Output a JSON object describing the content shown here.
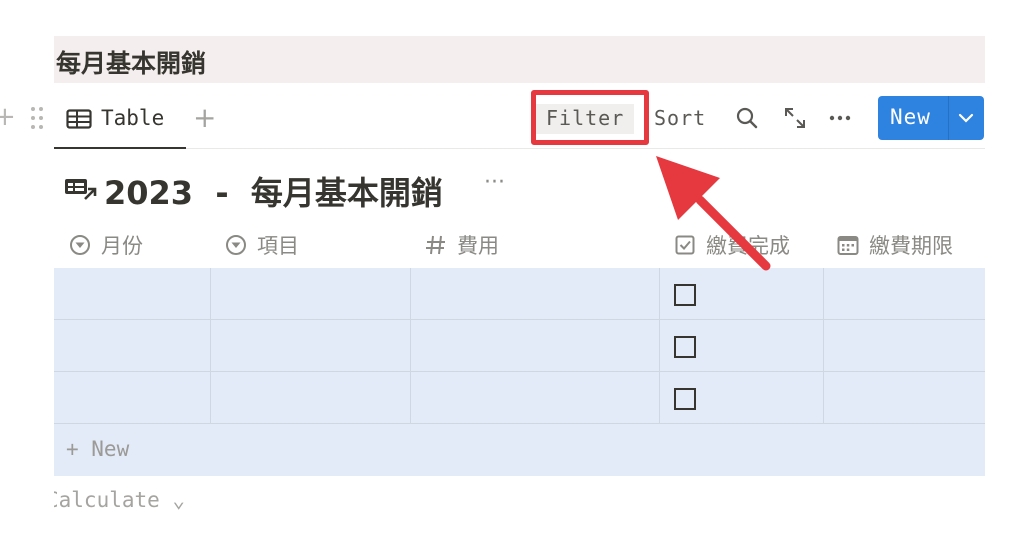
{
  "page": {
    "heading": "每月基本開銷"
  },
  "view_tabs": {
    "active_tab_label": "Table",
    "add_view_glyph": "+"
  },
  "toolbar": {
    "filter_label": "Filter",
    "sort_label": "Sort",
    "search_icon": "search-icon",
    "expand_icon": "expand-icon",
    "more_icon": "more-icon",
    "new_label": "New",
    "new_caret_icon": "chevron-down-icon"
  },
  "database": {
    "title": "2023  -  每月基本開銷",
    "more_glyph": "···",
    "columns": [
      {
        "label": "月份",
        "type": "select",
        "icon": "select-icon"
      },
      {
        "label": "項目",
        "type": "select",
        "icon": "select-icon"
      },
      {
        "label": "費用",
        "type": "number",
        "icon": "number-icon"
      },
      {
        "label": "繳費完成",
        "type": "checkbox",
        "icon": "checkbox-icon"
      },
      {
        "label": "繳費期限",
        "type": "date",
        "icon": "calendar-icon"
      }
    ],
    "rows": [
      {
        "month": "",
        "item": "",
        "cost": "",
        "paid": false,
        "deadline": ""
      },
      {
        "month": "",
        "item": "",
        "cost": "",
        "paid": false,
        "deadline": ""
      },
      {
        "month": "",
        "item": "",
        "cost": "",
        "paid": false,
        "deadline": ""
      }
    ],
    "add_row_label": "+ New",
    "calculate_label": "Calculate ⌄"
  },
  "annotation": {
    "highlight_color": "#e5383f",
    "highlighted_control": "Filter"
  },
  "colors": {
    "heading_bg": "#f4eeee",
    "row_bg": "#e2ebf7",
    "accent_blue": "#2f83e0",
    "text_main": "#37352f",
    "text_muted": "#8a8984"
  }
}
